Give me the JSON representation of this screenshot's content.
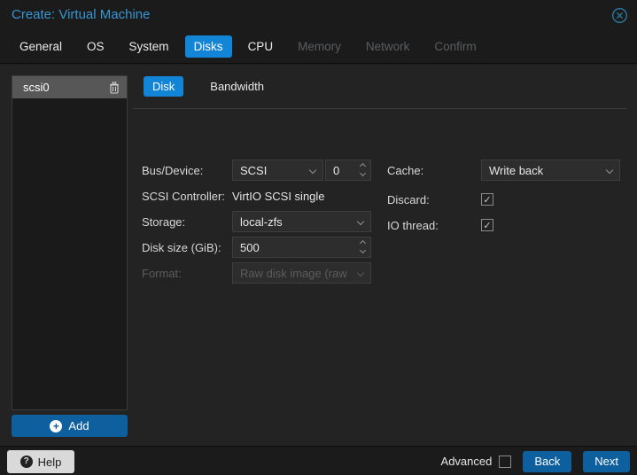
{
  "colors": {
    "accent_blue": "#1385d6",
    "button_blue": "#0d5f9e",
    "title_blue": "#3697d3"
  },
  "window": {
    "title": "Create: Virtual Machine"
  },
  "wizard_tabs": {
    "items": [
      {
        "label": "General",
        "state": "enabled"
      },
      {
        "label": "OS",
        "state": "enabled"
      },
      {
        "label": "System",
        "state": "enabled"
      },
      {
        "label": "Disks",
        "state": "active"
      },
      {
        "label": "CPU",
        "state": "enabled"
      },
      {
        "label": "Memory",
        "state": "disabled"
      },
      {
        "label": "Network",
        "state": "disabled"
      },
      {
        "label": "Confirm",
        "state": "disabled"
      }
    ]
  },
  "disk_list": {
    "items": [
      {
        "label": "scsi0",
        "selected": true
      }
    ],
    "add_button": "Add"
  },
  "inner_tabs": {
    "items": [
      {
        "label": "Disk",
        "state": "active"
      },
      {
        "label": "Bandwidth",
        "state": "enabled"
      }
    ]
  },
  "form": {
    "bus_device": {
      "label": "Bus/Device:",
      "bus": "SCSI",
      "device": "0"
    },
    "scsi_controller": {
      "label": "SCSI Controller:",
      "value": "VirtIO SCSI single"
    },
    "storage": {
      "label": "Storage:",
      "value": "local-zfs"
    },
    "disk_size": {
      "label": "Disk size (GiB):",
      "value": "500"
    },
    "format": {
      "label": "Format:",
      "value": "Raw disk image (raw",
      "disabled": true
    },
    "cache": {
      "label": "Cache:",
      "value": "Write back"
    },
    "discard": {
      "label": "Discard:",
      "checked": true
    },
    "io_thread": {
      "label": "IO thread:",
      "checked": true
    }
  },
  "footer": {
    "help": "Help",
    "advanced": "Advanced",
    "advanced_checked": false,
    "back": "Back",
    "next": "Next"
  },
  "icons": {
    "check": "✓",
    "plus": "+",
    "question": "?"
  }
}
